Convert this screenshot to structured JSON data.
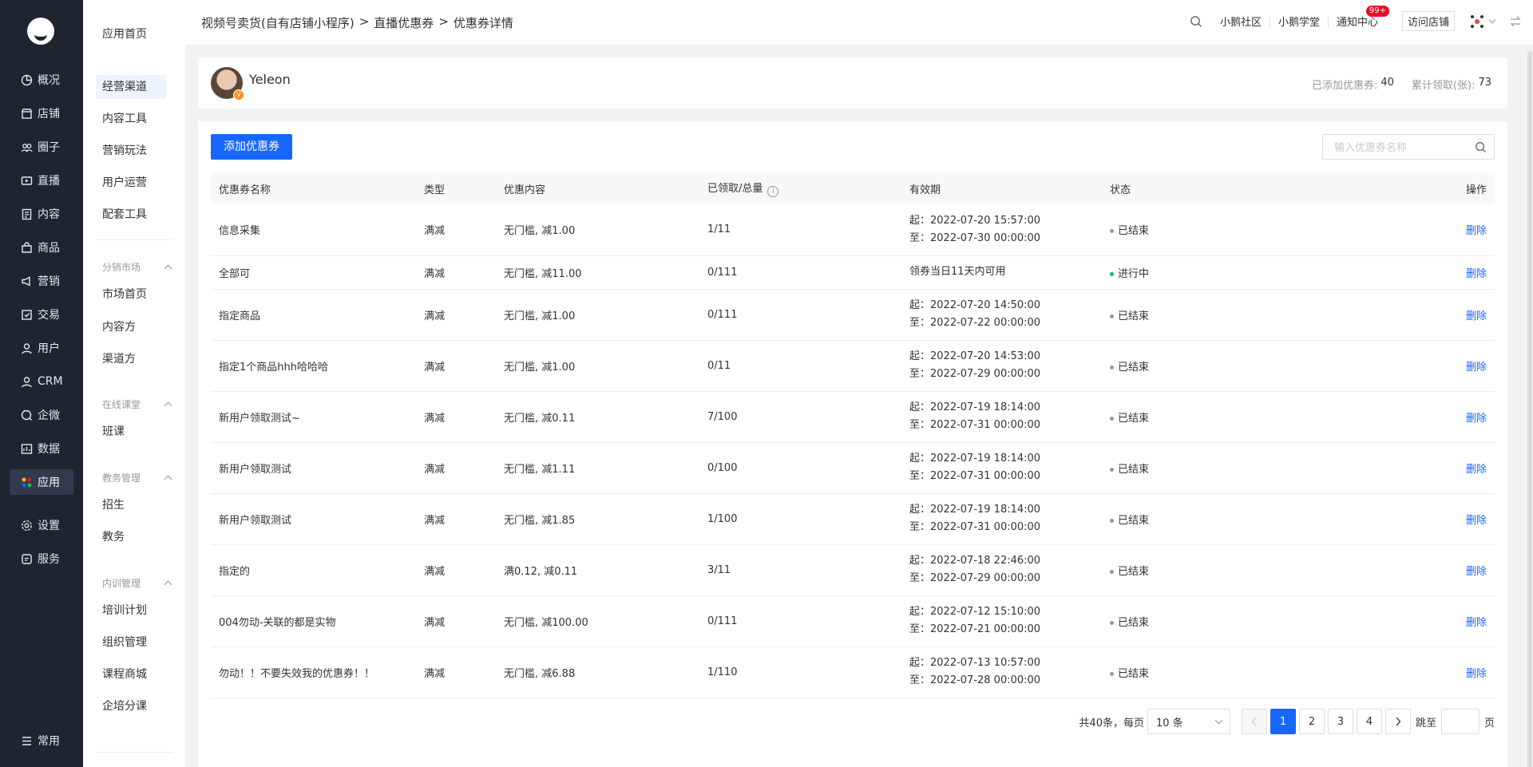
{
  "colors": {
    "primary": "#1966ff",
    "sidebar_bg": "#1f2431",
    "status_ended": "#969799",
    "status_active": "#07c160"
  },
  "primary_nav": [
    {
      "label": "概况",
      "icon": "overview-icon"
    },
    {
      "label": "店铺",
      "icon": "shop-icon"
    },
    {
      "label": "圈子",
      "icon": "community-icon"
    },
    {
      "label": "直播",
      "icon": "live-icon"
    },
    {
      "label": "内容",
      "icon": "content-icon"
    },
    {
      "label": "商品",
      "icon": "goods-icon"
    },
    {
      "label": "营销",
      "icon": "marketing-icon"
    },
    {
      "label": "交易",
      "icon": "trade-icon"
    },
    {
      "label": "用户",
      "icon": "user-icon"
    },
    {
      "label": "CRM",
      "icon": "crm-icon"
    },
    {
      "label": "企微",
      "icon": "wecom-icon"
    },
    {
      "label": "数据",
      "icon": "data-icon"
    },
    {
      "label": "应用",
      "icon": "apps-icon"
    },
    {
      "label": "设置",
      "icon": "settings-icon"
    },
    {
      "label": "服务",
      "icon": "service-icon"
    },
    {
      "label": "常用",
      "icon": "favorites-icon"
    }
  ],
  "secondary_nav": {
    "home": "应用首页",
    "items": [
      "经营渠道",
      "内容工具",
      "营销玩法",
      "用户运营",
      "配套工具"
    ],
    "groups": [
      {
        "title": "分销市场",
        "items": [
          "市场首页",
          "内容方",
          "渠道方"
        ]
      },
      {
        "title": "在线课堂",
        "items": [
          "班课"
        ]
      },
      {
        "title": "教务管理",
        "items": [
          "招生",
          "教务"
        ]
      },
      {
        "title": "内训管理",
        "items": [
          "培训计划",
          "组织管理",
          "课程商城",
          "企培分课"
        ]
      }
    ]
  },
  "header": {
    "breadcrumb": [
      "视频号卖货(自有店铺小程序)",
      ">",
      "直播优惠券",
      ">",
      "优惠券详情"
    ],
    "links": [
      "小鹅社区",
      "小鹅学堂",
      "通知中心"
    ],
    "badge": "99+",
    "visit_store": "访问店铺"
  },
  "profile": {
    "name": "Yeleon",
    "added_label": "已添加优惠券:",
    "added_value": "40",
    "received_label": "累计领取(张):",
    "received_value": "73"
  },
  "toolbar": {
    "add_label": "添加优惠券",
    "search_placeholder": "输入优惠券名称"
  },
  "table": {
    "columns": [
      "优惠券名称",
      "类型",
      "优惠内容",
      "已领取/总量",
      "有效期",
      "状态",
      "操作"
    ],
    "info_icon": "i",
    "rows": [
      {
        "name": "信息采集",
        "type": "满减",
        "content": "无门槛, 减1.00",
        "count": "1/11",
        "start": "起：2022-07-20 15:57:00",
        "end": "至：2022-07-30 00:00:00",
        "status": "已结束",
        "active": false,
        "op": "删除"
      },
      {
        "name": "全部可",
        "type": "满减",
        "content": "无门槛, 减11.00",
        "count": "0/111",
        "start": "领券当日11天内可用",
        "end": "",
        "status": "进行中",
        "active": true,
        "op": "删除"
      },
      {
        "name": "指定商品",
        "type": "满减",
        "content": "无门槛, 减1.00",
        "count": "0/111",
        "start": "起：2022-07-20 14:50:00",
        "end": "至：2022-07-22 00:00:00",
        "status": "已结束",
        "active": false,
        "op": "删除"
      },
      {
        "name": "指定1个商品hhh哈哈哈",
        "type": "满减",
        "content": "无门槛, 减1.00",
        "count": "0/11",
        "start": "起：2022-07-20 14:53:00",
        "end": "至：2022-07-29 00:00:00",
        "status": "已结束",
        "active": false,
        "op": "删除"
      },
      {
        "name": "新用户领取测试~",
        "type": "满减",
        "content": "无门槛, 减0.11",
        "count": "7/100",
        "start": "起：2022-07-19 18:14:00",
        "end": "至：2022-07-31 00:00:00",
        "status": "已结束",
        "active": false,
        "op": "删除"
      },
      {
        "name": "新用户领取测试",
        "type": "满减",
        "content": "无门槛, 减1.11",
        "count": "0/100",
        "start": "起：2022-07-19 18:14:00",
        "end": "至：2022-07-31 00:00:00",
        "status": "已结束",
        "active": false,
        "op": "删除"
      },
      {
        "name": "新用户领取测试",
        "type": "满减",
        "content": "无门槛, 减1.85",
        "count": "1/100",
        "start": "起：2022-07-19 18:14:00",
        "end": "至：2022-07-31 00:00:00",
        "status": "已结束",
        "active": false,
        "op": "删除"
      },
      {
        "name": "指定的",
        "type": "满减",
        "content": "满0.12, 减0.11",
        "count": "3/11",
        "start": "起：2022-07-18 22:46:00",
        "end": "至：2022-07-29 00:00:00",
        "status": "已结束",
        "active": false,
        "op": "删除"
      },
      {
        "name": "004勿动-关联的都是实物",
        "type": "满减",
        "content": "无门槛, 减100.00",
        "count": "0/111",
        "start": "起：2022-07-12 15:10:00",
        "end": "至：2022-07-21 00:00:00",
        "status": "已结束",
        "active": false,
        "op": "删除"
      },
      {
        "name": "勿动！！不要失效我的优惠券！！",
        "type": "满减",
        "content": "无门槛, 减6.88",
        "count": "1/110",
        "start": "起：2022-07-13 10:57:00",
        "end": "至：2022-07-28 00:00:00",
        "status": "已结束",
        "active": false,
        "op": "删除"
      }
    ]
  },
  "pagination": {
    "total": "共40条，每页",
    "page_size": "10 条",
    "pages": [
      "1",
      "2",
      "3",
      "4"
    ],
    "current": "1",
    "jump_label": "跳至",
    "page_unit": "页"
  }
}
